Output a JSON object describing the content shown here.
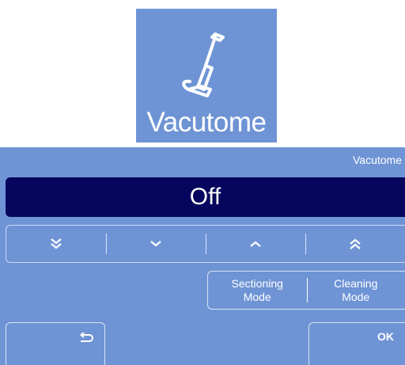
{
  "icon_tile": {
    "label": "Vacutome",
    "icon": "vacuum-cleaner-icon"
  },
  "panel": {
    "title": "Vacutome",
    "status": "Off",
    "stepper": {
      "buttons": [
        {
          "name": "fast-down",
          "icon": "double-chevron-down-icon"
        },
        {
          "name": "down",
          "icon": "chevron-down-icon"
        },
        {
          "name": "up",
          "icon": "chevron-up-icon"
        },
        {
          "name": "fast-up",
          "icon": "double-chevron-up-icon"
        }
      ]
    },
    "modes": [
      {
        "line1": "Sectioning",
        "line2": "Mode"
      },
      {
        "line1": "Cleaning",
        "line2": "Mode"
      }
    ],
    "back_icon": "return-arrow-icon",
    "ok_label": "OK"
  },
  "colors": {
    "panel_bg": "#6f94d5",
    "status_bg": "#06065e",
    "text": "#ffffff"
  }
}
